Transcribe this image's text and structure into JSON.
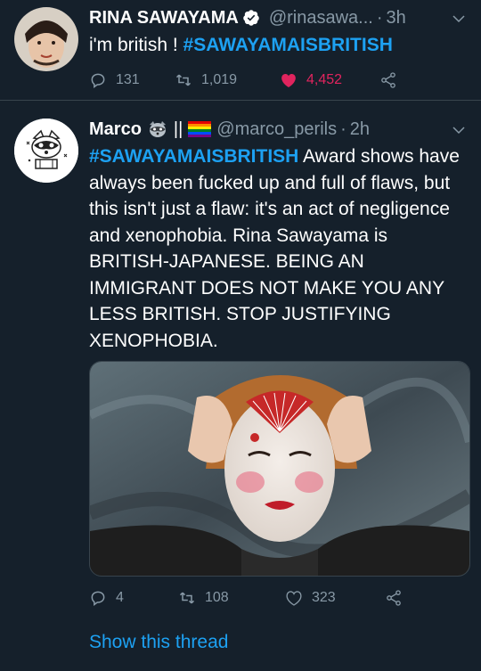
{
  "tweets": [
    {
      "display_name": "RINA SAWAYAMA",
      "handle": "@rinasawa...",
      "time": "3h",
      "text_plain": "i'm british ! ",
      "hashtag": "#SAWAYAMAISBRITISH",
      "replies": "131",
      "retweets": "1,019",
      "likes": "4,452",
      "liked": true,
      "verified": true
    },
    {
      "display_name": "Marco",
      "name_suffix": "||",
      "handle": "@marco_perils",
      "time": "2h",
      "hashtag": "#SAWAYAMAISBRITISH",
      "text_after_hashtag": " Award shows have always been fucked up and full of flaws, but this isn't just a flaw: it's an act of negligence and xenophobia. Rina Sawayama is BRITISH-JAPANESE. BEING AN IMMIGRANT DOES NOT MAKE YOU ANY LESS BRITISH. STOP JUSTIFYING XENOPHOBIA.",
      "replies": "4",
      "retweets": "108",
      "likes": "323",
      "show_thread": "Show this thread"
    }
  ],
  "colors": {
    "background": "#15202b",
    "accent": "#1da1f2",
    "muted": "#8899a6",
    "like": "#e0245e",
    "divider": "#38444d"
  },
  "icons": {
    "verified": "verified-badge-icon",
    "caret": "chevron-down-icon",
    "reply": "reply-icon",
    "retweet": "retweet-icon",
    "like": "heart-icon",
    "share": "share-icon",
    "raccoon": "raccoon-emoji-icon",
    "rainbow": "rainbow-flag-icon"
  }
}
